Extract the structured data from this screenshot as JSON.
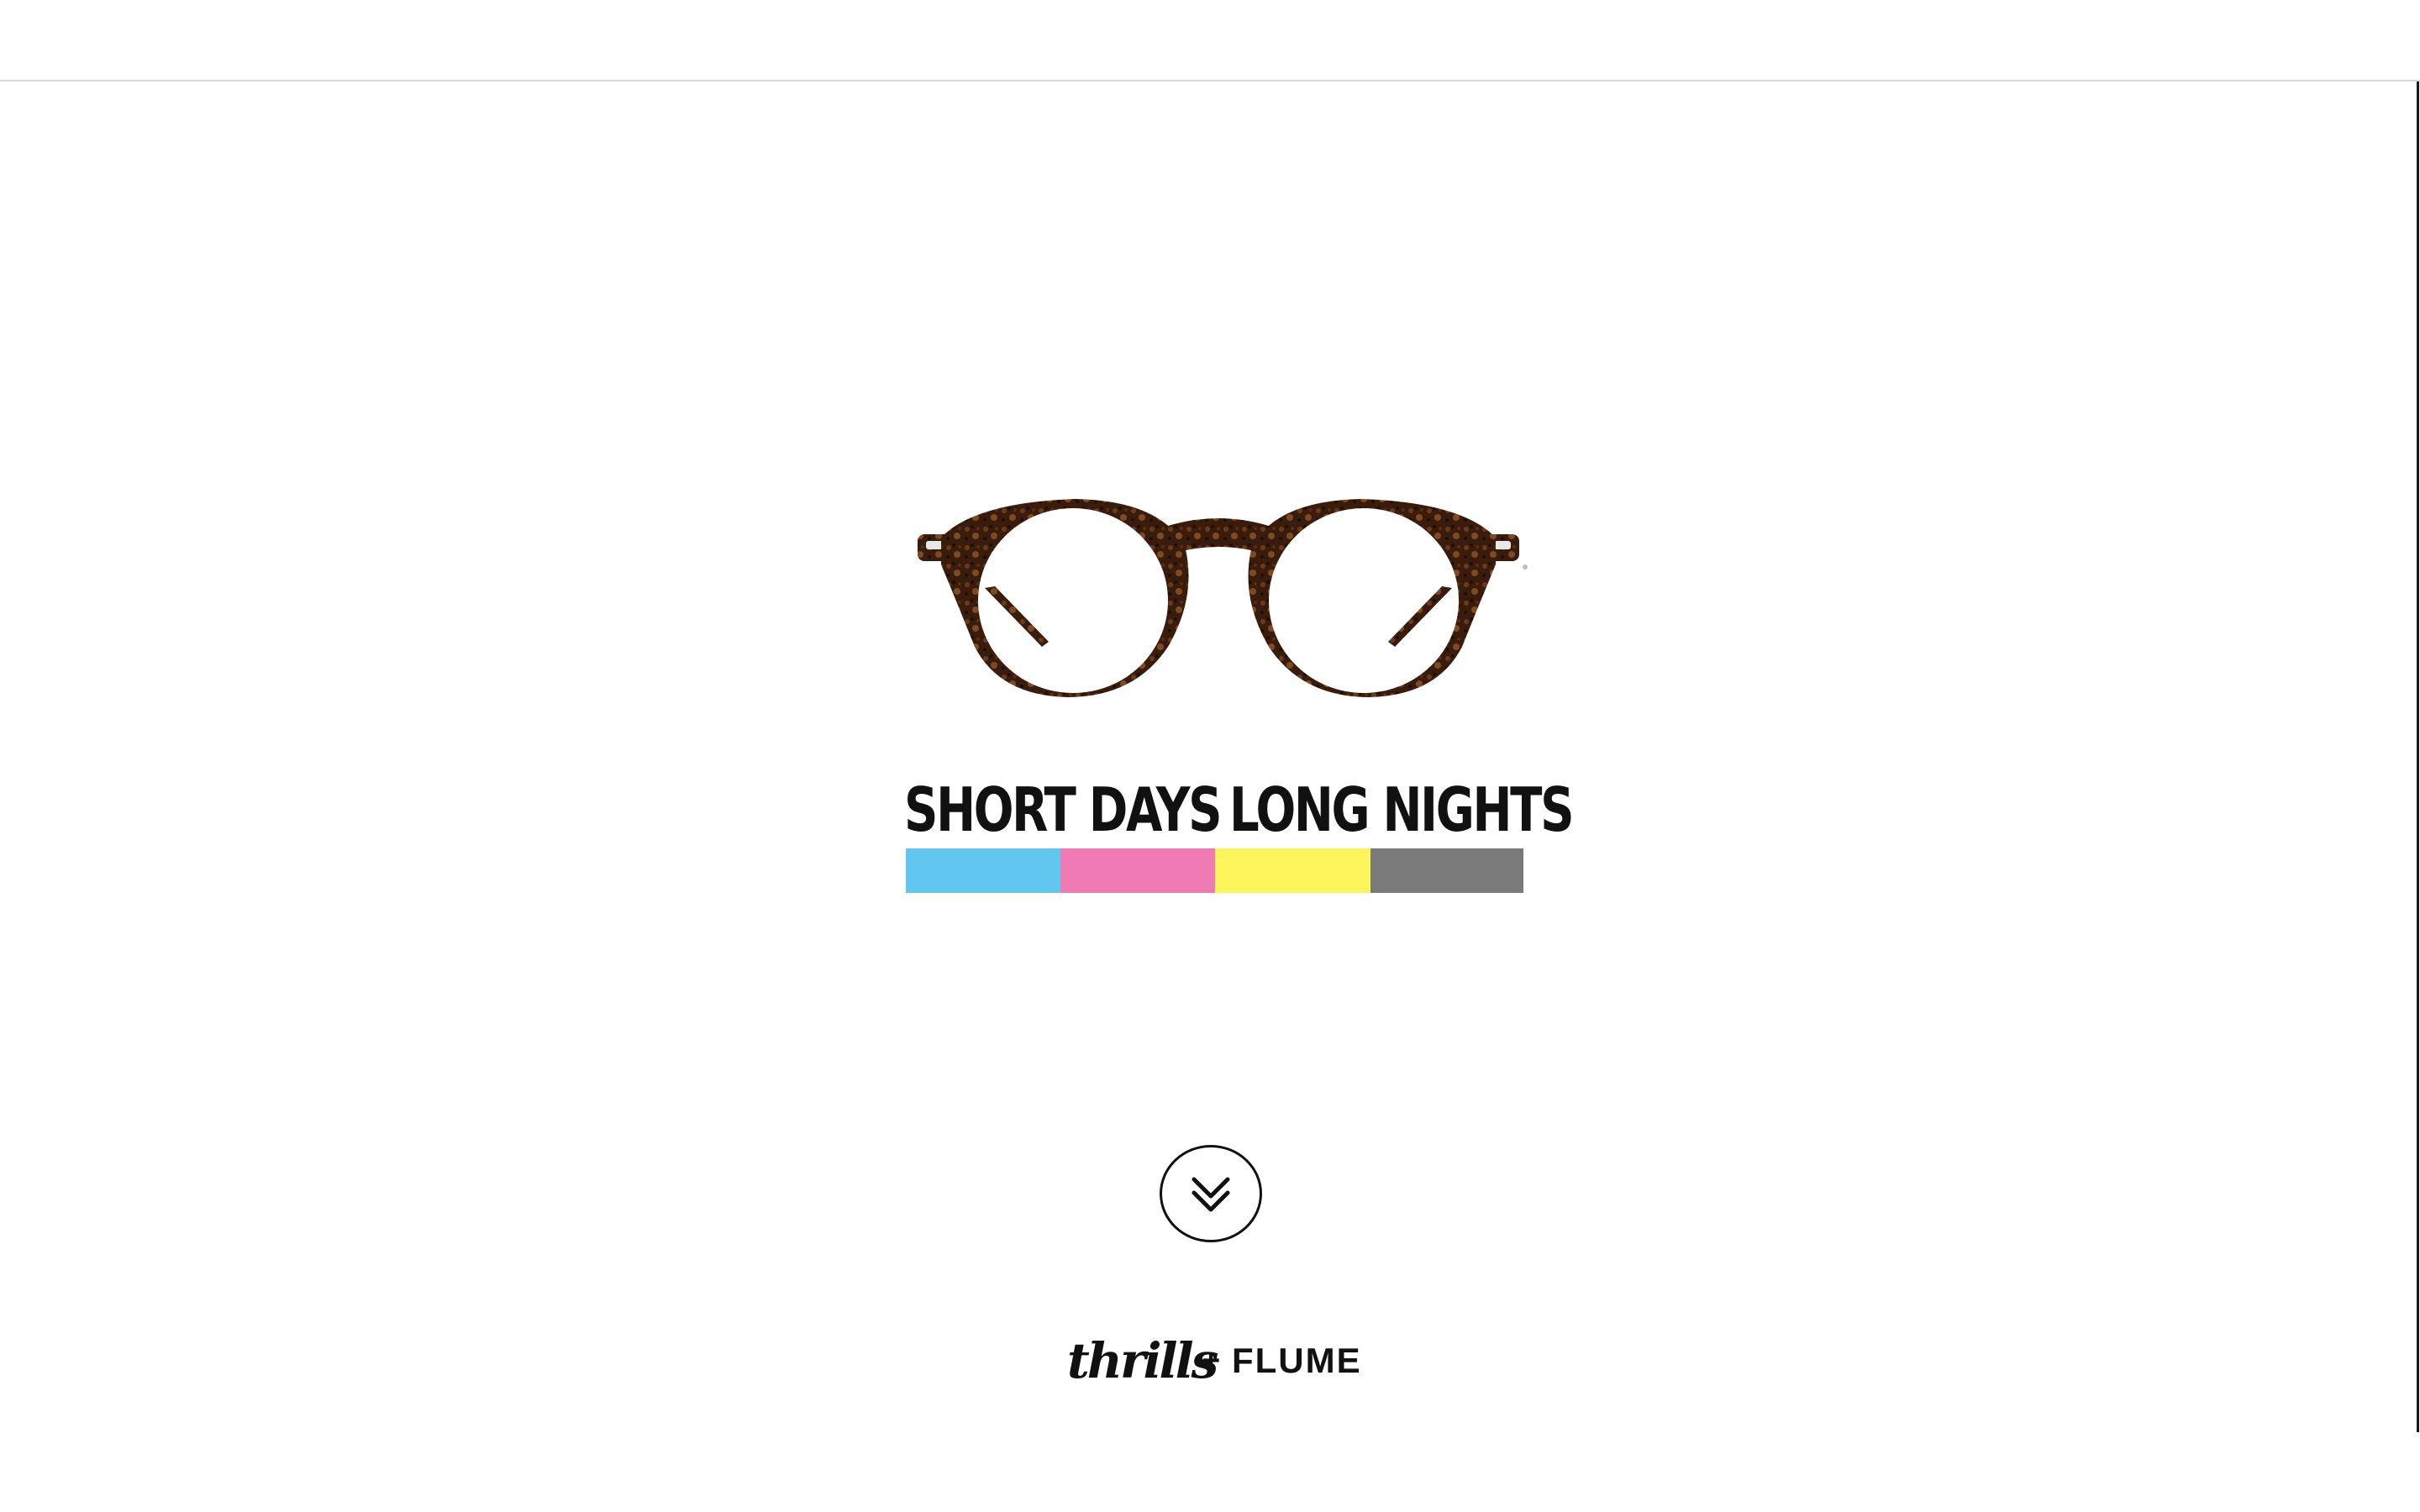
{
  "hero": {
    "tagline_left": "SHORT DAYS",
    "tagline_right": "LONG NIGHTS",
    "stripe_colors": [
      "#61c6f0",
      "#f07ab4",
      "#fcf55c",
      "#7a7a7a"
    ],
    "product_image": "tortoiseshell-round-glasses"
  },
  "scroll": {
    "icon": "double-chevron-down-icon"
  },
  "footer": {
    "brand_primary": "thrills",
    "brand_separator": "+",
    "brand_secondary": "FLUME"
  },
  "colors": {
    "frame_dark": "#2a1308",
    "frame_mid": "#5a3018",
    "frame_light": "#8a5a2e",
    "text": "#111111"
  }
}
